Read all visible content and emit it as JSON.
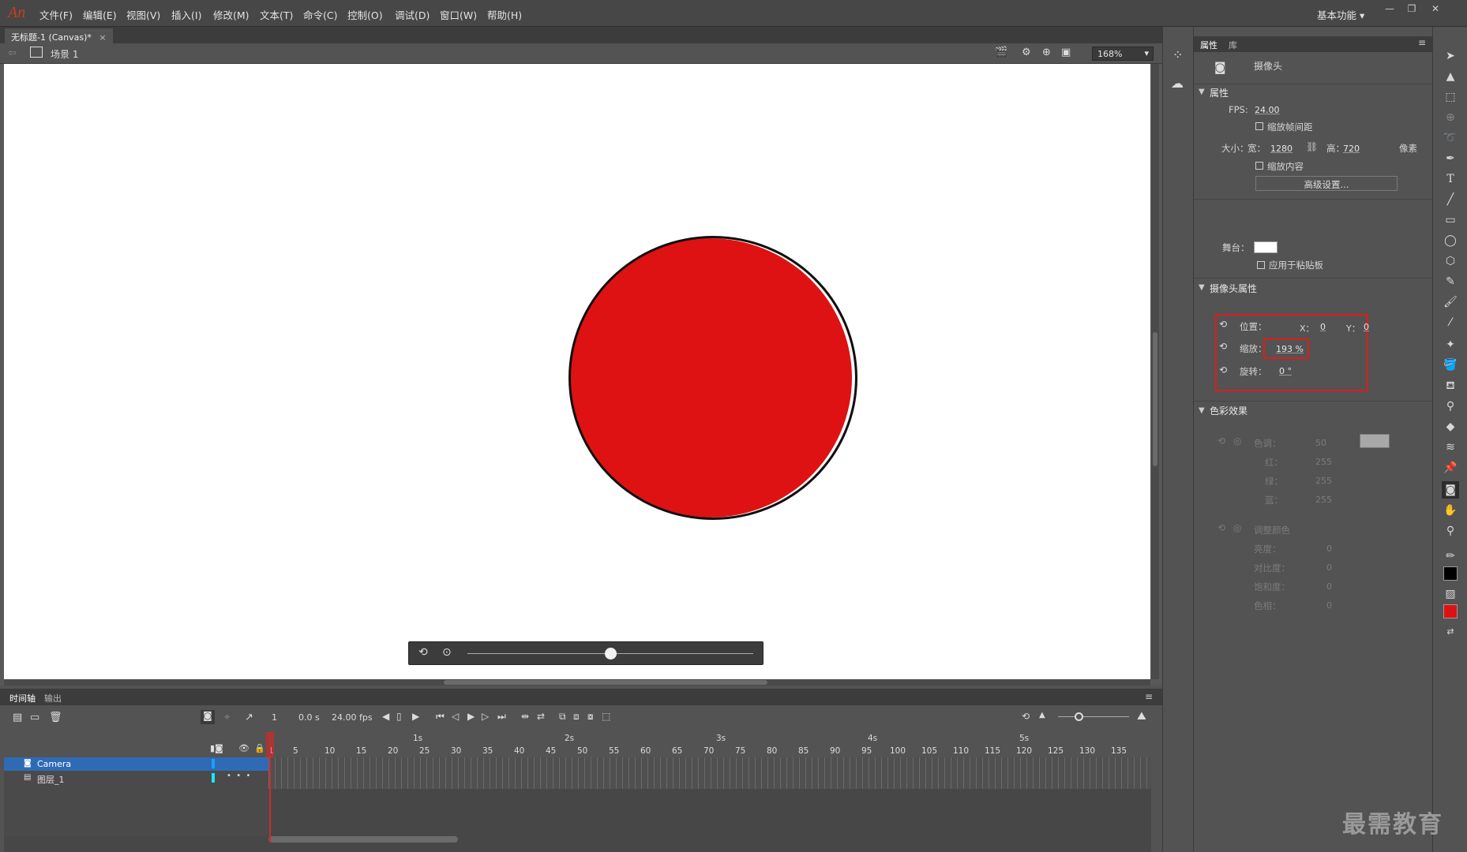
{
  "app": {
    "logo": "An",
    "workspace": "基本功能"
  },
  "menu": [
    "文件(F)",
    "编辑(E)",
    "视图(V)",
    "插入(I)",
    "修改(M)",
    "文本(T)",
    "命令(C)",
    "控制(O)",
    "调试(D)",
    "窗口(W)",
    "帮助(H)"
  ],
  "window_controls": {
    "minimize": "—",
    "restore": "❐",
    "close": "✕"
  },
  "document": {
    "tab_title": "无标题-1 (Canvas)*",
    "tab_close": "×",
    "scene": "场景 1",
    "zoom": "168%"
  },
  "stage": {
    "background": "#ffffff",
    "shape_color": "#de1212",
    "camera_slider_pct": 50
  },
  "timeline": {
    "tabs": [
      "时间轴",
      "输出"
    ],
    "current_frame": "1",
    "time": "0.0 s",
    "fps": "24.00 fps",
    "seconds": [
      "1s",
      "2s",
      "3s",
      "4s",
      "5s"
    ],
    "frame_numbers": [
      "1",
      "5",
      "10",
      "15",
      "20",
      "25",
      "30",
      "35",
      "40",
      "45",
      "50",
      "55",
      "60",
      "65",
      "70",
      "75",
      "80",
      "85",
      "90",
      "95",
      "100",
      "105",
      "110",
      "115",
      "120",
      "125",
      "130",
      "135"
    ],
    "layers": [
      {
        "name": "Camera",
        "selected": true
      },
      {
        "name": "图层_1",
        "selected": false
      }
    ]
  },
  "props": {
    "tabs": [
      "属性",
      "库"
    ],
    "object_name": "摄像头",
    "attributes_title": "属性",
    "fps_label": "FPS:",
    "fps_value": "24.00",
    "scale_spans": "缩放帧间距",
    "size_label": "大小：",
    "width_label": "宽：",
    "width_value": "1280",
    "height_label": "高：",
    "height_value": "720",
    "unit": "像素",
    "scale_content": "缩放内容",
    "advanced_button": "高级设置...",
    "stage_label": "舞台：",
    "stage_color": "#ffffff",
    "apply_pasteboard": "应用于粘贴板",
    "camera_title": "摄像头属性",
    "position_label": "位置：",
    "x_label": "X：",
    "x_value": "0",
    "y_label": "Y：",
    "y_value": "0",
    "zoom_label": "缩放：",
    "zoom_value": "193 %",
    "rotate_label": "旋转：",
    "rotate_value": "0 °",
    "color_effect_title": "色彩效果",
    "tint_label": "色调：",
    "tint_value": "50",
    "tint_swatch": "#a8a8a8",
    "red_label": "红：",
    "red_value": "255",
    "green_label": "绿：",
    "green_value": "255",
    "blue_label": "蓝：",
    "blue_value": "255",
    "adjust_label": "调整颜色",
    "brightness_label": "亮度：",
    "brightness_value": "0",
    "contrast_label": "对比度：",
    "contrast_value": "0",
    "saturation_label": "饱和度：",
    "saturation_value": "0",
    "hue_label": "色相：",
    "hue_value": "0"
  },
  "tools": {
    "stroke_color": "#000000",
    "fill_color": "#de1212"
  },
  "watermark": "最需教育"
}
